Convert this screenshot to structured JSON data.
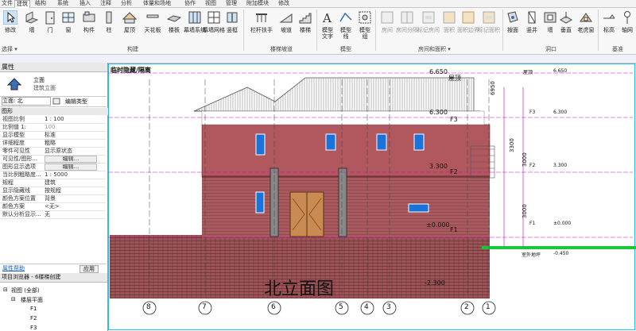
{
  "tabs": [
    "文件",
    "建筑",
    "结构",
    "系统",
    "插入",
    "注释",
    "分析",
    "体量和场地",
    "协作",
    "视图",
    "管理",
    "附加模块",
    "修改"
  ],
  "ribbon": {
    "buttons": [
      "修改",
      "墙",
      "门",
      "窗",
      "构件",
      "柱",
      "屋顶",
      "天花板",
      "楼板",
      "幕墙系统",
      "幕墙网格",
      "竖梃",
      "栏杆扶手",
      "坡道",
      "楼梯",
      "模型文字",
      "模型线",
      "模型组",
      "房间",
      "房间分隔",
      "标记房间",
      "面积",
      "面积边界",
      "标记面积",
      "按面",
      "竖井",
      "墙",
      "垂直",
      "老虎窗",
      "标高",
      "轴网",
      "设置"
    ],
    "groups": [
      "选择 ▾",
      "构建",
      "楼梯坡道",
      "模型",
      "房间和面积 ▾",
      "洞口",
      "基准"
    ]
  },
  "properties": {
    "title": "属性",
    "type_name": "立面",
    "type_sub": "建筑立面",
    "selector": "立面: 北",
    "edit_type": "编辑类型",
    "section": "图形",
    "rows": [
      {
        "k": "视图比例",
        "v": "1 : 100"
      },
      {
        "k": "比例值 1:",
        "v": "100"
      },
      {
        "k": "显示模型",
        "v": "标准"
      },
      {
        "k": "详细程度",
        "v": "粗略"
      },
      {
        "k": "零件可见性",
        "v": "显示原状态"
      },
      {
        "k": "可见性/图形...",
        "v": "编辑..."
      },
      {
        "k": "图形显示选项",
        "v": "编辑..."
      },
      {
        "k": "当比例粗略度...",
        "v": "1 : 5000"
      },
      {
        "k": "规程",
        "v": "建筑"
      },
      {
        "k": "显示隐藏线",
        "v": "按规程"
      },
      {
        "k": "颜色方案位置",
        "v": "背景"
      },
      {
        "k": "颜色方案",
        "v": "<无>"
      },
      {
        "k": "默认分析显示...",
        "v": "无"
      }
    ],
    "help": "属性帮助",
    "apply": "应用"
  },
  "browser": {
    "title": "项目浏览器 - 6楼梯创建",
    "items": [
      "视图 (全部)",
      "楼层平面",
      "F1",
      "F2",
      "F3"
    ]
  },
  "canvas": {
    "banner": "临时隐藏/隔离",
    "levels": [
      {
        "name": "屋顶",
        "elev": "6.650"
      },
      {
        "name": "F3",
        "elev": "6.300"
      },
      {
        "name": "F2",
        "elev": "3.300"
      },
      {
        "name": "F1",
        "elev": "±0.000"
      },
      {
        "name": "",
        "elev": "-2.300"
      }
    ],
    "dims": [
      "6950",
      "3300",
      "3000",
      "3000"
    ],
    "right_levels": [
      {
        "name": "屋顶",
        "elev": "6.650"
      },
      {
        "name": "F3",
        "elev": "6.300"
      },
      {
        "name": "F2",
        "elev": "3.300"
      },
      {
        "name": "F1",
        "elev": "±0.000"
      },
      {
        "name": "室外地坪",
        "elev": "-0.450"
      }
    ],
    "grids": [
      "8",
      "7",
      "6",
      "5",
      "4",
      "3",
      "2",
      "1"
    ],
    "title_text": "北立面图"
  }
}
